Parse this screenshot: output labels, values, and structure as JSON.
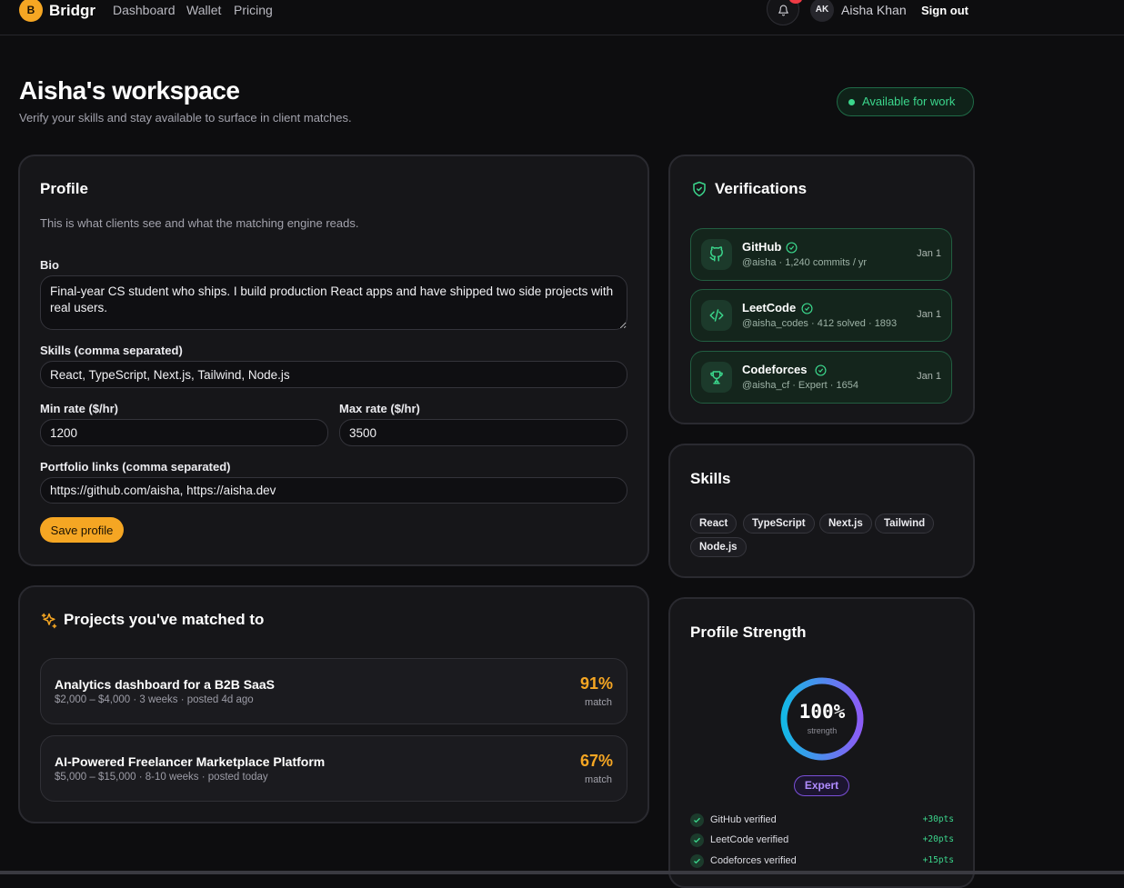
{
  "nav": {
    "logo_letter": "B",
    "brand": "Bridgr",
    "links": [
      "Dashboard",
      "Wallet",
      "Pricing"
    ],
    "avatar_initials": "AK",
    "user_name": "Aisha Khan",
    "sign_out": "Sign out"
  },
  "header": {
    "title": "Aisha's workspace",
    "subtitle": "Verify your skills and stay available to surface in client matches.",
    "availability": "Available for work"
  },
  "profile": {
    "title": "Profile",
    "description": "This is what clients see and what the matching engine reads.",
    "bio_label": "Bio",
    "bio_value": "Final-year CS student who ships. I build production React apps and have shipped two side projects with real users.",
    "skills_label": "Skills (comma separated)",
    "skills_value": "React, TypeScript, Next.js, Tailwind, Node.js",
    "min_rate_label": "Min rate ($/hr)",
    "min_rate_value": "1200",
    "max_rate_label": "Max rate ($/hr)",
    "max_rate_value": "3500",
    "portfolio_label": "Portfolio links (comma separated)",
    "portfolio_value": "https://github.com/aisha, https://aisha.dev",
    "save_label": "Save profile"
  },
  "projects": {
    "title": "Projects you've matched to",
    "items": [
      {
        "title": "Analytics dashboard for a B2B SaaS",
        "meta": "$2,000 – $4,000 · 3 weeks · posted 4d ago",
        "pct": "91%",
        "match": "match"
      },
      {
        "title": "AI-Powered Freelancer Marketplace Platform",
        "meta": "$5,000 – $15,000 · 8-10 weeks · posted today",
        "pct": "67%",
        "match": "match"
      }
    ]
  },
  "verifications": {
    "title": "Verifications",
    "items": [
      {
        "name": "GitHub",
        "meta": "@aisha · 1,240 commits / yr",
        "date": "Jan 1",
        "icon": "github-icon"
      },
      {
        "name": "LeetCode",
        "meta": "@aisha_codes · 412 solved · 1893",
        "date": "Jan 1",
        "icon": "code-icon"
      },
      {
        "name": "Codeforces",
        "meta": "@aisha_cf · Expert · 1654",
        "date": "Jan 1",
        "icon": "trophy-icon"
      }
    ]
  },
  "skills": {
    "title": "Skills",
    "chips": [
      "React",
      "TypeScript",
      "Next.js",
      "Tailwind",
      "Node.js"
    ]
  },
  "strength": {
    "title": "Profile Strength",
    "value_text": "100%",
    "value": 100,
    "caption": "strength",
    "level": "Expert",
    "criteria": [
      {
        "label": "GitHub verified",
        "points": "+30pts"
      },
      {
        "label": "LeetCode verified",
        "points": "+20pts"
      },
      {
        "label": "Codeforces verified",
        "points": "+15pts"
      }
    ]
  },
  "colors": {
    "accent": "#f5a623",
    "success": "#3bd68c",
    "expert": "#b08cff"
  }
}
